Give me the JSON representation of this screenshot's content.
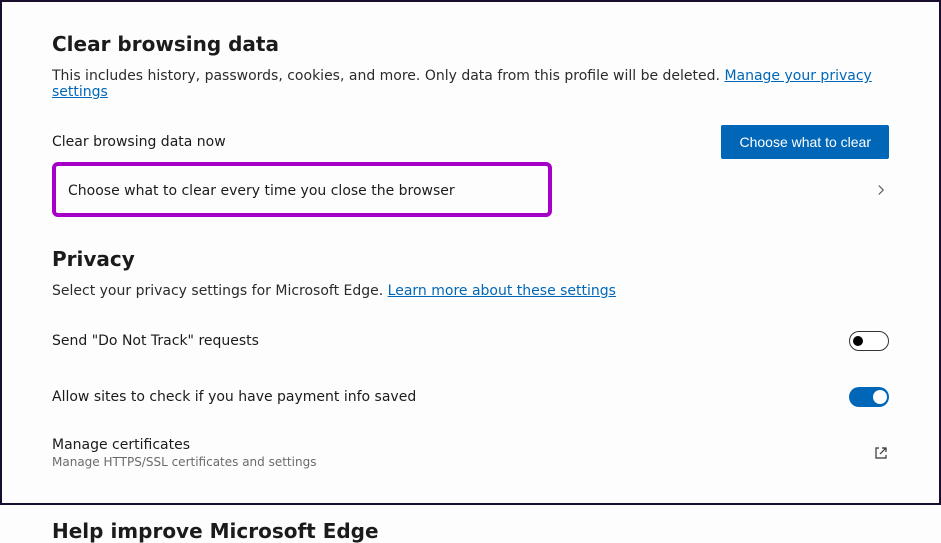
{
  "section1": {
    "title": "Clear browsing data",
    "desc": "This includes history, passwords, cookies, and more. Only data from this profile will be deleted. ",
    "descLink": "Manage your privacy settings",
    "row1Label": "Clear browsing data now",
    "row1Button": "Choose what to clear",
    "row2Label": "Choose what to clear every time you close the browser"
  },
  "section2": {
    "title": "Privacy",
    "desc": "Select your privacy settings for Microsoft Edge. ",
    "descLink": "Learn more about these settings",
    "rowDNT": "Send \"Do Not Track\" requests",
    "rowPayment": "Allow sites to check if you have payment info saved",
    "rowCert": "Manage certificates",
    "rowCertSub": "Manage HTTPS/SSL certificates and settings"
  },
  "section3": {
    "title": "Help improve Microsoft Edge"
  }
}
